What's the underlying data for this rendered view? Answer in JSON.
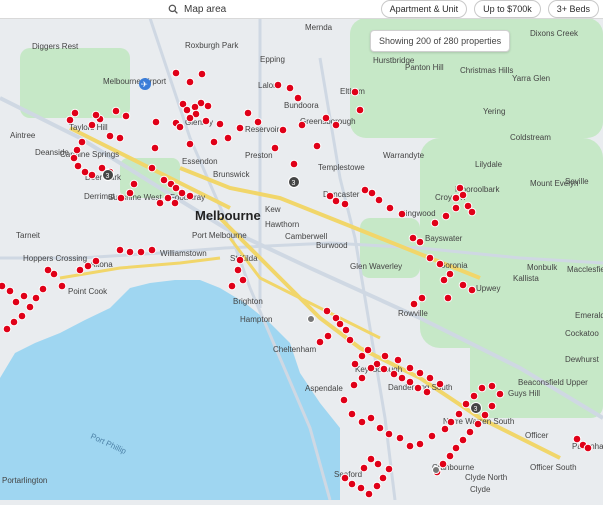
{
  "header": {
    "search_placeholder": "Map area",
    "filters": [
      {
        "label": "Apartment & Unit"
      },
      {
        "label": "Up to $700k"
      },
      {
        "label": "3+ Beds"
      }
    ]
  },
  "overlay": {
    "count_text": "Showing 200 of 280 properties"
  },
  "map": {
    "center_label": "Melbourne",
    "airport_label": "Melbourne Airport",
    "bay_label": "Port Phillip",
    "colors": {
      "marker_red": "#e00018",
      "marker_dark": "#444444",
      "marker_gray": "#777777",
      "land": "#e9ecef",
      "water": "#9fd6f1",
      "parks": "#c6e8c7",
      "primary_road": "#f1d66a",
      "secondary_road": "#cfd8e3"
    },
    "labels": [
      {
        "text": "Diggers Rest"
      },
      {
        "text": "Roxburgh Park"
      },
      {
        "text": "Mernda"
      },
      {
        "text": "Epping"
      },
      {
        "text": "Hurstbridge"
      },
      {
        "text": "Panton Hill"
      },
      {
        "text": "Christmas Hills"
      },
      {
        "text": "Dixons Creek"
      },
      {
        "text": "Yarra Glen"
      },
      {
        "text": "Melbourne Airport"
      },
      {
        "text": "Lalor"
      },
      {
        "text": "Bundoora"
      },
      {
        "text": "Eltham"
      },
      {
        "text": "Greensborough"
      },
      {
        "text": "Yering"
      },
      {
        "text": "Coldstream"
      },
      {
        "text": "Taylors Hill"
      },
      {
        "text": "Glenroy"
      },
      {
        "text": "Reservoir"
      },
      {
        "text": "Aintree"
      },
      {
        "text": "Deanside"
      },
      {
        "text": "Caroline Springs"
      },
      {
        "text": "Essendon"
      },
      {
        "text": "Preston"
      },
      {
        "text": "Warrandyte"
      },
      {
        "text": "Lilydale"
      },
      {
        "text": "Brunswick"
      },
      {
        "text": "Templestowe"
      },
      {
        "text": "Mooroolbark"
      },
      {
        "text": "Mount Evelyn"
      },
      {
        "text": "Seville"
      },
      {
        "text": "Deer Park"
      },
      {
        "text": "Sunshine West"
      },
      {
        "text": "Footscray"
      },
      {
        "text": "Derrimut"
      },
      {
        "text": "Doncaster"
      },
      {
        "text": "Croydon"
      },
      {
        "text": "Kew"
      },
      {
        "text": "Hawthorn"
      },
      {
        "text": "Port Melbourne"
      },
      {
        "text": "Ringwood"
      },
      {
        "text": "Tarneit"
      },
      {
        "text": "Altona"
      },
      {
        "text": "Williamstown"
      },
      {
        "text": "Camberwell"
      },
      {
        "text": "Burwood"
      },
      {
        "text": "Bayswater"
      },
      {
        "text": "Hoppers Crossing"
      },
      {
        "text": "Point Cook"
      },
      {
        "text": "St Kilda"
      },
      {
        "text": "Boronia"
      },
      {
        "text": "Monbulk"
      },
      {
        "text": "Macclesfield"
      },
      {
        "text": "Glen Waverley"
      },
      {
        "text": "Kallista"
      },
      {
        "text": "Upwey"
      },
      {
        "text": "Brighton"
      },
      {
        "text": "Rowville"
      },
      {
        "text": "Emerald"
      },
      {
        "text": "Hampton"
      },
      {
        "text": "Cockatoo"
      },
      {
        "text": "Cheltenham"
      },
      {
        "text": "Dewhurst"
      },
      {
        "text": "Keysborough"
      },
      {
        "text": "Beaconsfield Upper"
      },
      {
        "text": "Dandenong South"
      },
      {
        "text": "Guys Hill"
      },
      {
        "text": "Aspendale"
      },
      {
        "text": "Narre Warren South"
      },
      {
        "text": "Officer"
      },
      {
        "text": "Pakenham"
      },
      {
        "text": "Cranbourne"
      },
      {
        "text": "Clyde North"
      },
      {
        "text": "Officer South"
      },
      {
        "text": "Seaford"
      },
      {
        "text": "Clyde"
      },
      {
        "text": "Portarlington"
      }
    ]
  }
}
